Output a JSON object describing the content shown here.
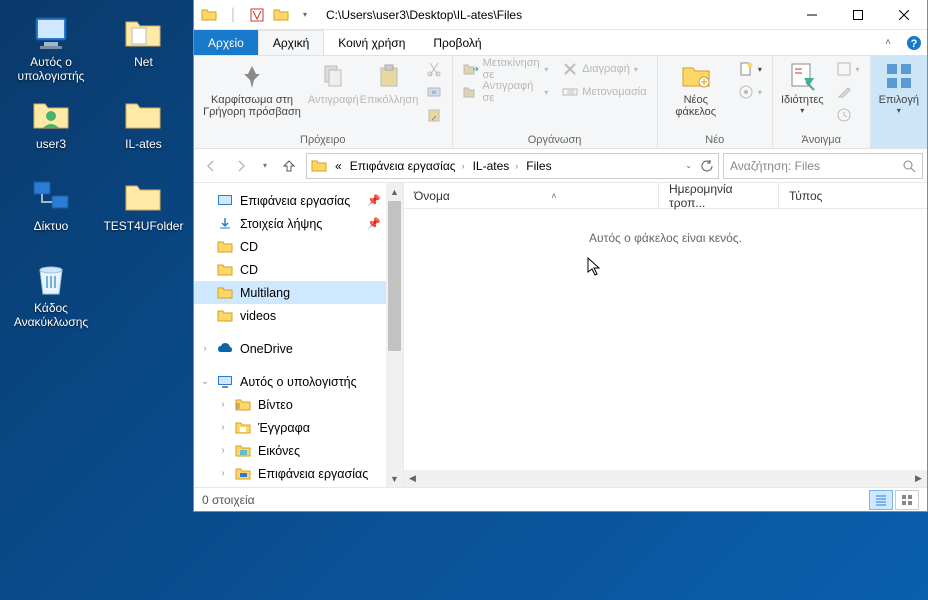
{
  "desktop": {
    "icons": [
      {
        "name": "this-pc",
        "label": "Αυτός ο υπολογιστής"
      },
      {
        "name": "net",
        "label": "Net"
      },
      {
        "name": "user3",
        "label": "user3"
      },
      {
        "name": "il-ates",
        "label": "IL-ates"
      },
      {
        "name": "network",
        "label": "Δίκτυο"
      },
      {
        "name": "test4u",
        "label": "TEST4UFolder"
      },
      {
        "name": "recycle",
        "label": "Κάδος Ανακύκλωσης"
      }
    ]
  },
  "window": {
    "title": "C:\\Users\\user3\\Desktop\\IL-ates\\Files",
    "menu": {
      "file": "Αρχείο",
      "home": "Αρχική",
      "share": "Κοινή χρήση",
      "view": "Προβολή"
    },
    "ribbon": {
      "pin": "Καρφίτσωμα στη Γρήγορη πρόσβαση",
      "copy": "Αντιγραφή",
      "paste": "Επικόλληση",
      "clipboard_label": "Πρόχειρο",
      "moveto": "Μετακίνηση σε",
      "copyto": "Αντιγραφή σε",
      "delete": "Διαγραφή",
      "rename": "Μετονομασία",
      "organize_label": "Οργάνωση",
      "newfolder": "Νέος φάκελος",
      "new_label": "Νέο",
      "properties": "Ιδιότητες",
      "open_label": "Άνοιγμα",
      "select": "Επιλογή"
    },
    "breadcrumb": {
      "desktop": "Επιφάνεια εργασίας",
      "ilates": "IL-ates",
      "files": "Files"
    },
    "search_placeholder": "Αναζήτηση: Files",
    "tree": {
      "desktop": "Επιφάνεια εργασίας",
      "downloads": "Στοιχεία λήψης",
      "cd1": "CD",
      "cd2": "CD",
      "multilang": "Multilang",
      "videos": "videos",
      "onedrive": "OneDrive",
      "thispc": "Αυτός ο υπολογιστής",
      "video": "Βίντεο",
      "documents": "Έγγραφα",
      "pictures": "Εικόνες",
      "desk2": "Επιφάνεια εργασίας"
    },
    "columns": {
      "name": "Όνομα",
      "date": "Ημερομηνία τροπ...",
      "type": "Τύπος"
    },
    "empty": "Αυτός ο φάκελος είναι κενός.",
    "status": "0 στοιχεία"
  }
}
